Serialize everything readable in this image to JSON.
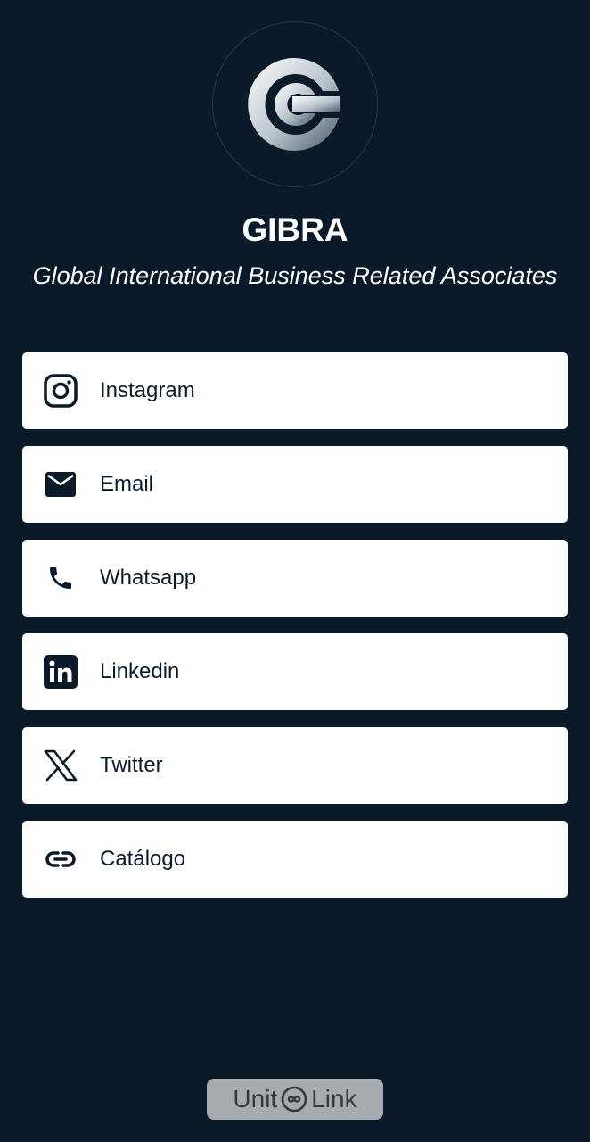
{
  "profile": {
    "name": "GIBRA",
    "tagline": "Global International Business Related Associates",
    "logo_icon": "gibra-g-logo-icon"
  },
  "links": [
    {
      "label": "Instagram",
      "icon": "instagram-icon"
    },
    {
      "label": "Email",
      "icon": "mail-icon"
    },
    {
      "label": "Whatsapp",
      "icon": "phone-icon"
    },
    {
      "label": "Linkedin",
      "icon": "linkedin-icon"
    },
    {
      "label": "Twitter",
      "icon": "x-twitter-icon"
    },
    {
      "label": "Catálogo",
      "icon": "link-icon"
    }
  ],
  "footer": {
    "brand_left": "Unit",
    "brand_right": "Link",
    "icon": "infinity-link-icon"
  },
  "colors": {
    "background": "#0b1a29",
    "card": "#ffffff",
    "text_dark": "#0b1a29",
    "footer_badge": "#a7aaae"
  }
}
